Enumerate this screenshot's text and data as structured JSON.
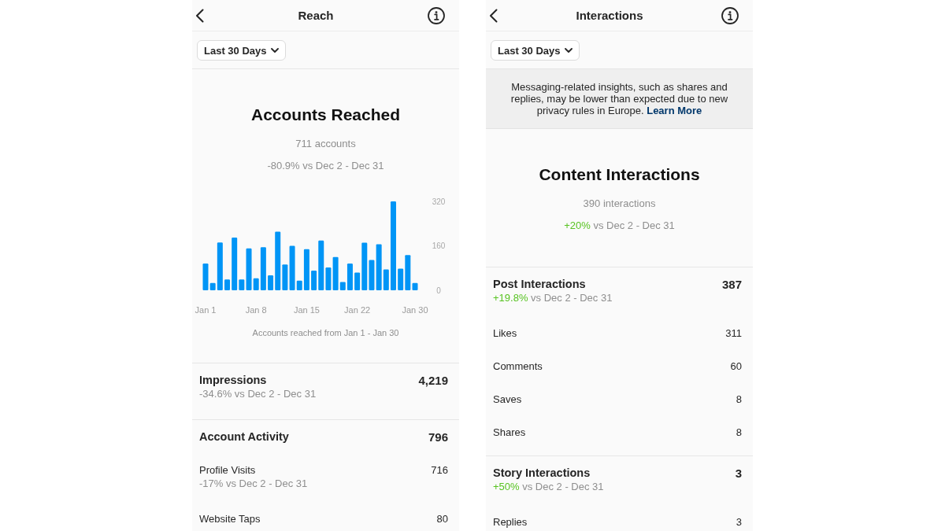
{
  "panels": [
    {
      "title": "Reach",
      "date_filter": "Last 30 Days",
      "sections": [
        {
          "kind": "summary",
          "title": "Accounts Reached",
          "count": "711 accounts",
          "change": {
            "delta": "-80.9%",
            "positive": false,
            "period": "vs Dec 2 - Dec 31"
          },
          "chart_data": {
            "type": "bar",
            "categories": [
              "Jan 1",
              null,
              null,
              null,
              null,
              null,
              null,
              "Jan 8",
              null,
              null,
              null,
              null,
              null,
              null,
              "Jan 15",
              null,
              null,
              null,
              null,
              null,
              null,
              "Jan 22",
              null,
              null,
              null,
              null,
              null,
              null,
              null,
              "Jan 30"
            ],
            "values": [
              96,
              26,
              172,
              39,
              190,
              39,
              151,
              43,
              155,
              54,
              211,
              93,
              160,
              35,
              148,
              71,
              179,
              82,
              120,
              30,
              96,
              64,
              171,
              109,
              166,
              75,
              320,
              78,
              127,
              26
            ],
            "ylim": [
              0,
              320
            ],
            "yticks": [
              0,
              160,
              320
            ]
          },
          "caption": "Accounts reached from Jan 1 - Jan 30"
        },
        {
          "kind": "metrics",
          "rows": [
            {
              "kind": "primary",
              "label": "Impressions",
              "value": "4,219",
              "change": {
                "delta": "-34.6%",
                "positive": false,
                "period": "vs Dec 2 - Dec 31"
              }
            }
          ]
        },
        {
          "kind": "metrics",
          "rows": [
            {
              "kind": "primary",
              "label": "Account Activity",
              "value": "796"
            },
            {
              "kind": "secondary",
              "label": "Profile Visits",
              "value": "716",
              "change": {
                "delta": "-17%",
                "positive": false,
                "period": "vs Dec 2 - Dec 31"
              }
            },
            {
              "kind": "secondary",
              "label": "Website Taps",
              "value": "80"
            }
          ]
        }
      ]
    },
    {
      "title": "Interactions",
      "date_filter": "Last 30 Days",
      "sections": [
        {
          "kind": "notice",
          "text": "Messaging-related insights, such as shares and replies, may be lower than expected due to new privacy rules in Europe.",
          "link": "Learn More"
        },
        {
          "kind": "summary",
          "title": "Content Interactions",
          "count": "390 interactions",
          "change": {
            "delta": "+20%",
            "positive": true,
            "period": "vs Dec 2 - Dec 31"
          }
        },
        {
          "kind": "metrics",
          "rows": [
            {
              "kind": "primary",
              "label": "Post Interactions",
              "value": "387",
              "change": {
                "delta": "+19.8%",
                "positive": true,
                "period": "vs Dec 2 - Dec 31"
              }
            },
            {
              "kind": "secondary",
              "label": "Likes",
              "value": "311"
            },
            {
              "kind": "secondary",
              "label": "Comments",
              "value": "60"
            },
            {
              "kind": "secondary",
              "label": "Saves",
              "value": "8"
            },
            {
              "kind": "secondary",
              "label": "Shares",
              "value": "8"
            }
          ]
        },
        {
          "kind": "metrics",
          "rows": [
            {
              "kind": "primary",
              "label": "Story Interactions",
              "value": "3",
              "change": {
                "delta": "+50%",
                "positive": true,
                "period": "vs Dec 2 - Dec 31"
              }
            },
            {
              "kind": "secondary",
              "label": "Replies",
              "value": "3"
            }
          ]
        }
      ]
    }
  ]
}
